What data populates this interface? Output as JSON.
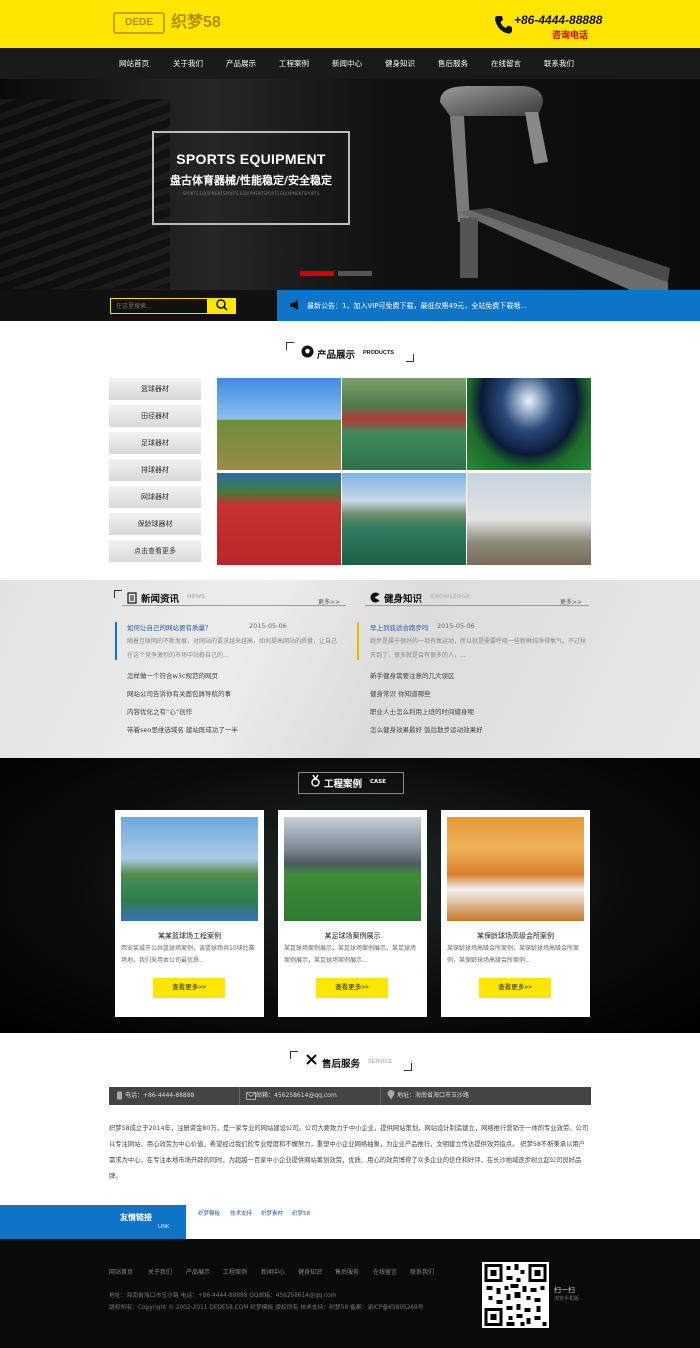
{
  "header": {
    "logo_text": "DEDE",
    "logo_name": "织梦58",
    "phone": "+86-4444-88888",
    "phone_label": "咨询电话"
  },
  "nav": [
    "网站首页",
    "关于我们",
    "产品展示",
    "工程案例",
    "新闻中心",
    "健身知识",
    "售后服务",
    "在线留言",
    "联系我们"
  ],
  "banner": {
    "title_en": "SPORTS EQUIPMENT",
    "title_cn": "盘古体育器械/性能稳定/安全稳定",
    "small_text": "SPORTS EQUIPMENTSPORTS EQUIPMENTSPORTS EQUIPMENTSPORTS"
  },
  "search": {
    "placeholder": "在这里搜索..."
  },
  "notice": "最新公告：1，加入VIP可免费下载，最低仅需49元，全站免费下载哦...",
  "products": {
    "title_cn": "产品展示",
    "title_en": "PRODUCTS",
    "categories": [
      "篮球器材",
      "田径器材",
      "足球器材",
      "排球器材",
      "网球器材",
      "保龄球器材",
      "点击查看更多"
    ]
  },
  "news": {
    "title_cn": "新闻资讯",
    "title_en": "NEWS",
    "more": "更多>>",
    "featured_title": "如何让自己的网站更有质量？",
    "featured_date": "2015-05-06",
    "featured_summary": "随着互联网的不断发展，对网站的要求越来越高，如何提高网站的质量，让自己在这个竞争激烈的市场中站稳自己的...",
    "items": [
      "怎样做一个符合w3c规范的网页",
      "网站公司告诉你有关面包屑导航的事",
      "内容优化之有“心”创作",
      "带着seo思维选域名 建站既成功了一半"
    ]
  },
  "knowledge": {
    "title_cn": "健身知识",
    "title_en": "KNOWLEDGE",
    "more": "更多>>",
    "featured_title": "早上到底适合跑步吗",
    "featured_date": "2015-05-06",
    "featured_summary": "跑步是属于很好的一项有氧运动，所以就是需要呼吸一些新鲜纯净得氧气。不过秋天到了，很多就是会有很多的人，...",
    "items": [
      "新手健身需要注意的几大误区",
      "健身常识 你知道哪些",
      "职业人士怎么利用上班的时间健身呢",
      "怎么健身效果最好 饭后散步运动效果好"
    ]
  },
  "cases": {
    "title_cn": "工程案例",
    "title_en": "CASE",
    "cards": [
      {
        "title": "某某篮球场工程案例",
        "desc": "西安某城市公共篮球场案例，该篮球场共10块比赛场地，我们采用本公司最优质...",
        "button": "查看更多>>"
      },
      {
        "title": "某足球场案例展示",
        "desc": "某足球场案例展示，某足球场案例展示，某足球场案例展示，某足球场案例展示...",
        "button": "查看更多>>"
      },
      {
        "title": "某保龄球场高级会所案例",
        "desc": "某保龄球场高级会所案例，某保龄球场高级会所案例，某保龄球场高级会所案例...",
        "button": "查看更多>>"
      }
    ]
  },
  "service": {
    "title_cn": "售后服务",
    "title_en": "SERVICE",
    "phone": "电话：+86-4444-88888",
    "email": "邮箱：456258614@qq.com",
    "address": "地址：海南省海口市玉沙路",
    "about": "织梦58成立于2014年，注册资金80万，是一家专业的网站建设公司。公司大要致力于中小企业，提供网站策划，网站设计制造建立，网络推行营销于一体的专业效劳。公司以专注网站，用心效劳为中心价值，希望经过我们的专业程度和不懈努力，重塑中小企业网络抽象，为企业产品推行，文明建立传达提供效劳指点。 织梦58不断秉承以用户需求为中心，在专注本地市场开辟的同时，为超越一百家中小企业提供网站筹划效劳，优质、用心的效劳博得了众多企业的信任和好评，在长沙地域逐步树立起公司良好品牌。"
  },
  "links": {
    "label": "友情链接",
    "label_en": "LINK",
    "items": [
      "织梦模板",
      "技术支持",
      "织梦素材",
      "织梦58"
    ]
  },
  "footer": {
    "nav": [
      "网站首页",
      "关于我们",
      "产品展示",
      "工程案例",
      "新闻中心",
      "健身知识",
      "售后服务",
      "在线留言",
      "联系我们"
    ],
    "line1": "地址：海南省海口市玉沙路 电话：+86-4444-88888 QQ邮箱：456258614@qq.com",
    "line2": "版权所有：Copyright © 2002-2011 DEDE58.COM 织梦模板 版权所有 技术支持：织梦58 备案：渝ICP备65895269号",
    "qr_label": "扫一扫",
    "qr_sub": "浏览手机版"
  },
  "colors": {
    "accent": "#ffe600",
    "blue": "#0e74c8",
    "red": "#d60000",
    "dark": "#1a1a1a"
  }
}
